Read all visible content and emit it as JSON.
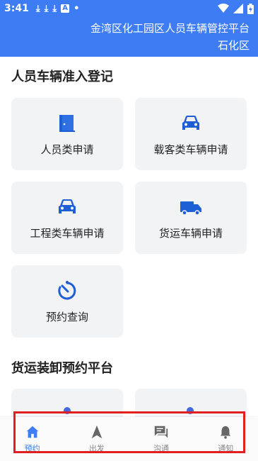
{
  "status_bar": {
    "time": "3:41",
    "notification_icons": [
      "download-icon",
      "download-icon",
      "download-icon",
      "font-icon",
      "dot-icon"
    ],
    "right_icons": [
      "wifi-icon",
      "signal-icon",
      "battery-icon"
    ]
  },
  "header": {
    "title_line1": "金湾区化工园区人员车辆管控平台",
    "title_line2": "石化区"
  },
  "section1": {
    "title": "人员车辆准入登记",
    "cards": [
      {
        "label": "人员类申请",
        "icon": "door-icon"
      },
      {
        "label": "载客类车辆申请",
        "icon": "car-icon"
      },
      {
        "label": "工程类车辆申请",
        "icon": "car-icon"
      },
      {
        "label": "货运车辆申请",
        "icon": "truck-icon"
      },
      {
        "label": "预约查询",
        "icon": "timer-icon"
      }
    ]
  },
  "section2": {
    "title": "货运装卸预约平台"
  },
  "tabbar": {
    "tabs": [
      {
        "label": "预约",
        "icon": "home-icon",
        "active": true
      },
      {
        "label": "出发",
        "icon": "navigation-icon",
        "active": false
      },
      {
        "label": "沟通",
        "icon": "chat-icon",
        "active": false
      },
      {
        "label": "通知",
        "icon": "bell-icon",
        "active": false
      }
    ]
  },
  "colors": {
    "accent": "#3d7cf2",
    "card_bg": "#f2f3f5",
    "highlight": "#e02020"
  }
}
